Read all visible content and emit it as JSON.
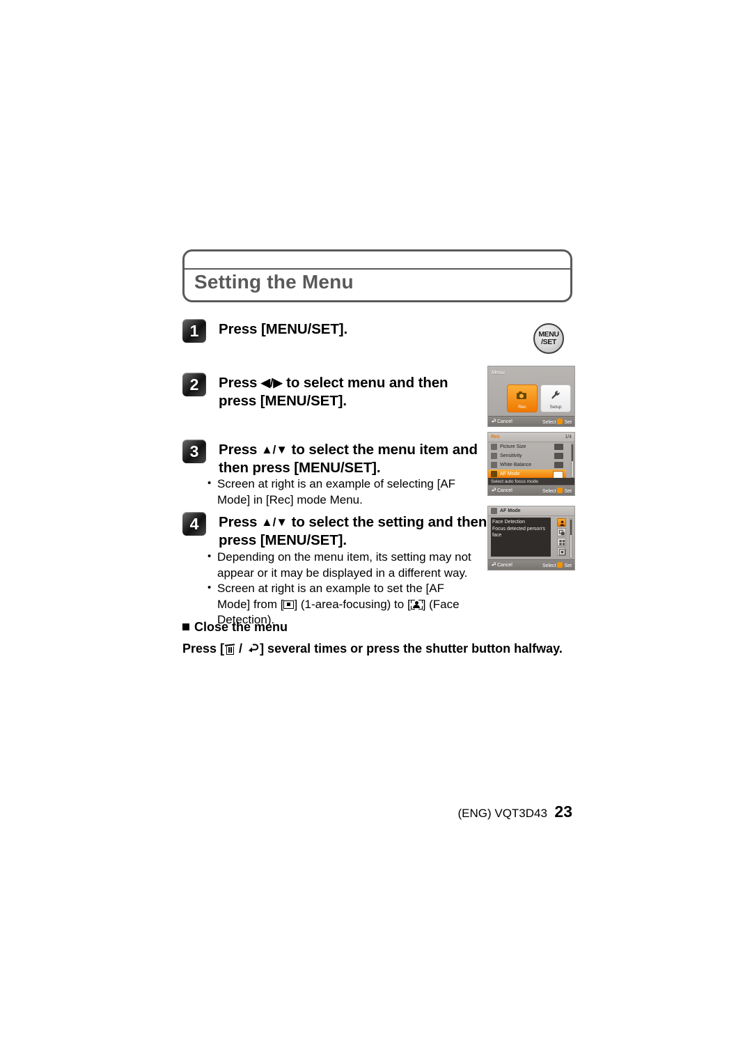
{
  "page": {
    "title": "Setting the Menu",
    "footer": {
      "manual_code": "(ENG) VQT3D43",
      "page_number": "23"
    }
  },
  "steps": [
    {
      "number": "1",
      "text": "Press [MENU/SET]."
    },
    {
      "number": "2",
      "line1_before": "Press ",
      "arrows": "◀/▶",
      "line1_after": " to select menu and then",
      "line2": "press [MENU/SET]."
    },
    {
      "number": "3",
      "line1_before": "Press ",
      "arrows": "▲/▼",
      "line1_after": " to select the menu item and",
      "line2": "then press [MENU/SET].",
      "bullets": [
        "Screen at right is an example of selecting [AF Mode] in [Rec] mode Menu."
      ]
    },
    {
      "number": "4",
      "line1_before": "Press ",
      "arrows": "▲/▼",
      "line1_after": " to select the setting and then",
      "line2": "press [MENU/SET].",
      "bullets": [
        "Depending on the menu item, its setting may not appear or it may be displayed in a different way.",
        "Screen at right is an example to set the [AF Mode] from [ICON_1AREA] (1-area-focusing) to [ICON_FACE] (Face Detection)."
      ],
      "bullet2_parts": {
        "a": "Screen at right is an example to set the [AF Mode]",
        "b": "from [",
        "c": "] (1-area-focusing) to [",
        "d": "] (Face",
        "e": "Detection)."
      }
    }
  ],
  "close_menu": {
    "heading": "Close the menu",
    "line_a": "Press [",
    "line_b": " / ",
    "line_c": "] several times or press the shutter button halfway."
  },
  "menuset_button": {
    "line1": "MENU",
    "line2": "/SET"
  },
  "screenshots": [
    {
      "id": "menu-picker",
      "label": "Menu",
      "tiles": [
        {
          "caption": "Rec",
          "selected": true
        },
        {
          "caption": "Setup",
          "selected": false
        }
      ],
      "footer": {
        "cancel": "Cancel",
        "select": "Select",
        "set": "Set"
      }
    },
    {
      "id": "rec-menu",
      "header_tag": "Rec",
      "page_indicator": "1/4",
      "rows": [
        {
          "label": "Picture Size",
          "selected": false
        },
        {
          "label": "Sensitivity",
          "selected": false
        },
        {
          "label": "White Balance",
          "selected": false
        },
        {
          "label": "AF Mode",
          "selected": true
        }
      ],
      "help_text": "Select auto focus mode",
      "footer": {
        "cancel": "Cancel",
        "select": "Select",
        "set": "Set"
      }
    },
    {
      "id": "af-mode-settings",
      "header_title": "AF Mode",
      "description_line1": "Face Detection",
      "description_line2": "Focus detected person's",
      "description_line3": "face",
      "options": [
        {
          "name": "face-detection",
          "selected": true
        },
        {
          "name": "af-tracking",
          "selected": false
        },
        {
          "name": "23-area-focusing",
          "selected": false
        },
        {
          "name": "1-area-focusing",
          "selected": false
        }
      ],
      "footer": {
        "cancel": "Cancel",
        "select": "Select",
        "set": "Set"
      }
    }
  ],
  "colors": {
    "accent_orange": "#f07800",
    "title_gray": "#595959",
    "lcd_gray": "#b9b5b2"
  }
}
